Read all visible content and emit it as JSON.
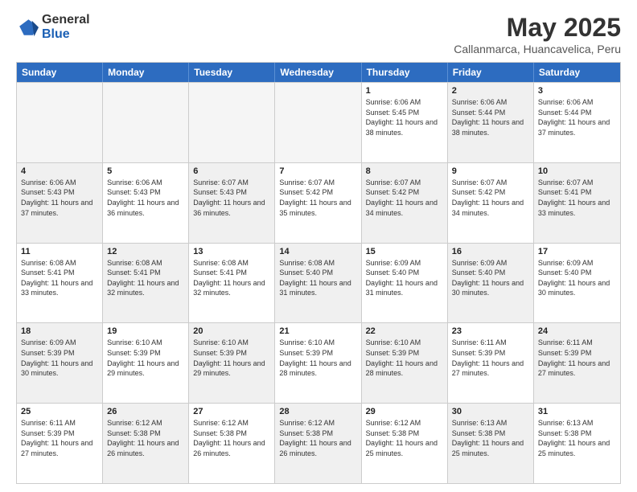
{
  "logo": {
    "general": "General",
    "blue": "Blue"
  },
  "title": "May 2025",
  "subtitle": "Callanmarca, Huancavelica, Peru",
  "header_days": [
    "Sunday",
    "Monday",
    "Tuesday",
    "Wednesday",
    "Thursday",
    "Friday",
    "Saturday"
  ],
  "rows": [
    [
      {
        "day": "",
        "empty": true
      },
      {
        "day": "",
        "empty": true
      },
      {
        "day": "",
        "empty": true
      },
      {
        "day": "",
        "empty": true
      },
      {
        "day": "1",
        "sunrise": "6:06 AM",
        "sunset": "5:45 PM",
        "daylight": "11 hours and 38 minutes."
      },
      {
        "day": "2",
        "sunrise": "6:06 AM",
        "sunset": "5:44 PM",
        "daylight": "11 hours and 38 minutes."
      },
      {
        "day": "3",
        "sunrise": "6:06 AM",
        "sunset": "5:44 PM",
        "daylight": "11 hours and 37 minutes."
      }
    ],
    [
      {
        "day": "4",
        "sunrise": "6:06 AM",
        "sunset": "5:43 PM",
        "daylight": "11 hours and 37 minutes."
      },
      {
        "day": "5",
        "sunrise": "6:06 AM",
        "sunset": "5:43 PM",
        "daylight": "11 hours and 36 minutes."
      },
      {
        "day": "6",
        "sunrise": "6:07 AM",
        "sunset": "5:43 PM",
        "daylight": "11 hours and 36 minutes."
      },
      {
        "day": "7",
        "sunrise": "6:07 AM",
        "sunset": "5:42 PM",
        "daylight": "11 hours and 35 minutes."
      },
      {
        "day": "8",
        "sunrise": "6:07 AM",
        "sunset": "5:42 PM",
        "daylight": "11 hours and 34 minutes."
      },
      {
        "day": "9",
        "sunrise": "6:07 AM",
        "sunset": "5:42 PM",
        "daylight": "11 hours and 34 minutes."
      },
      {
        "day": "10",
        "sunrise": "6:07 AM",
        "sunset": "5:41 PM",
        "daylight": "11 hours and 33 minutes."
      }
    ],
    [
      {
        "day": "11",
        "sunrise": "6:08 AM",
        "sunset": "5:41 PM",
        "daylight": "11 hours and 33 minutes."
      },
      {
        "day": "12",
        "sunrise": "6:08 AM",
        "sunset": "5:41 PM",
        "daylight": "11 hours and 32 minutes."
      },
      {
        "day": "13",
        "sunrise": "6:08 AM",
        "sunset": "5:41 PM",
        "daylight": "11 hours and 32 minutes."
      },
      {
        "day": "14",
        "sunrise": "6:08 AM",
        "sunset": "5:40 PM",
        "daylight": "11 hours and 31 minutes."
      },
      {
        "day": "15",
        "sunrise": "6:09 AM",
        "sunset": "5:40 PM",
        "daylight": "11 hours and 31 minutes."
      },
      {
        "day": "16",
        "sunrise": "6:09 AM",
        "sunset": "5:40 PM",
        "daylight": "11 hours and 30 minutes."
      },
      {
        "day": "17",
        "sunrise": "6:09 AM",
        "sunset": "5:40 PM",
        "daylight": "11 hours and 30 minutes."
      }
    ],
    [
      {
        "day": "18",
        "sunrise": "6:09 AM",
        "sunset": "5:39 PM",
        "daylight": "11 hours and 30 minutes."
      },
      {
        "day": "19",
        "sunrise": "6:10 AM",
        "sunset": "5:39 PM",
        "daylight": "11 hours and 29 minutes."
      },
      {
        "day": "20",
        "sunrise": "6:10 AM",
        "sunset": "5:39 PM",
        "daylight": "11 hours and 29 minutes."
      },
      {
        "day": "21",
        "sunrise": "6:10 AM",
        "sunset": "5:39 PM",
        "daylight": "11 hours and 28 minutes."
      },
      {
        "day": "22",
        "sunrise": "6:10 AM",
        "sunset": "5:39 PM",
        "daylight": "11 hours and 28 minutes."
      },
      {
        "day": "23",
        "sunrise": "6:11 AM",
        "sunset": "5:39 PM",
        "daylight": "11 hours and 27 minutes."
      },
      {
        "day": "24",
        "sunrise": "6:11 AM",
        "sunset": "5:39 PM",
        "daylight": "11 hours and 27 minutes."
      }
    ],
    [
      {
        "day": "25",
        "sunrise": "6:11 AM",
        "sunset": "5:39 PM",
        "daylight": "11 hours and 27 minutes."
      },
      {
        "day": "26",
        "sunrise": "6:12 AM",
        "sunset": "5:38 PM",
        "daylight": "11 hours and 26 minutes."
      },
      {
        "day": "27",
        "sunrise": "6:12 AM",
        "sunset": "5:38 PM",
        "daylight": "11 hours and 26 minutes."
      },
      {
        "day": "28",
        "sunrise": "6:12 AM",
        "sunset": "5:38 PM",
        "daylight": "11 hours and 26 minutes."
      },
      {
        "day": "29",
        "sunrise": "6:12 AM",
        "sunset": "5:38 PM",
        "daylight": "11 hours and 25 minutes."
      },
      {
        "day": "30",
        "sunrise": "6:13 AM",
        "sunset": "5:38 PM",
        "daylight": "11 hours and 25 minutes."
      },
      {
        "day": "31",
        "sunrise": "6:13 AM",
        "sunset": "5:38 PM",
        "daylight": "11 hours and 25 minutes."
      }
    ]
  ]
}
